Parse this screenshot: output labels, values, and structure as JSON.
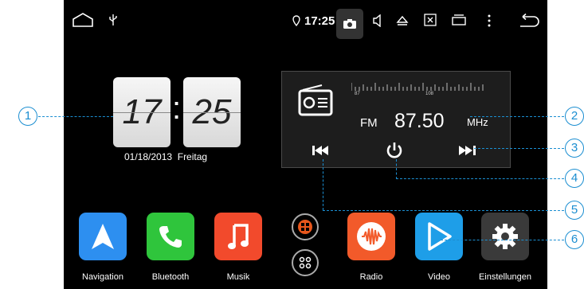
{
  "status_bar": {
    "time": "17:25",
    "icons": [
      "home-icon",
      "usb-icon",
      "location-icon",
      "camera-icon",
      "volume-icon",
      "eject-icon",
      "screenshot-icon",
      "recent-apps-icon",
      "more-icon",
      "back-icon"
    ]
  },
  "clock": {
    "hour": "17",
    "minute": "25",
    "date": "01/18/2013",
    "weekday": "Freitag"
  },
  "radio": {
    "band": "FM",
    "frequency": "87.50",
    "unit": "MHz",
    "scale_min": "87",
    "scale_max": "108"
  },
  "apps": [
    {
      "label": "Navigation",
      "color": "#2d8ff0",
      "icon": "navigation-icon"
    },
    {
      "label": "Bluetooth",
      "color": "#2fc53c",
      "icon": "phone-icon"
    },
    {
      "label": "Musik",
      "color": "#f24a2c",
      "icon": "music-icon"
    },
    {
      "label": "Radio",
      "color": "#f25a2a",
      "icon": "radio-wave-icon"
    },
    {
      "label": "Video",
      "color": "#1e9ee8",
      "icon": "play-icon"
    },
    {
      "label": "Einstellungen",
      "color": "#3a3a3a",
      "icon": "settings-icon"
    }
  ],
  "callouts": [
    "1",
    "2",
    "3",
    "4",
    "5",
    "6"
  ],
  "accent": "#1b8ed1"
}
